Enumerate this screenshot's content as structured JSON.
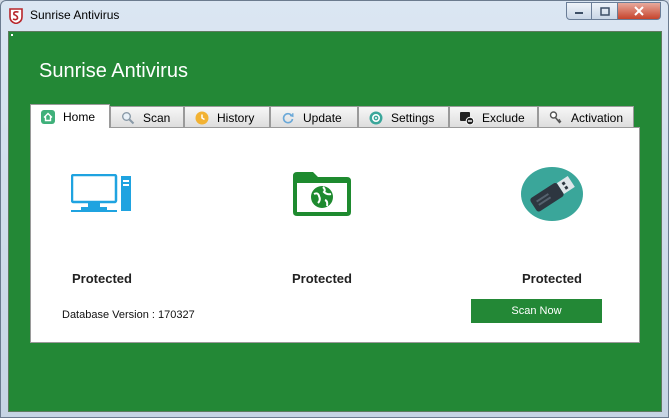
{
  "window": {
    "title": "Sunrise Antivirus"
  },
  "app": {
    "heading": "Sunrise Antivirus"
  },
  "tabs": [
    {
      "label": "Home",
      "icon": "home-icon"
    },
    {
      "label": "Scan",
      "icon": "magnifier-icon"
    },
    {
      "label": "History",
      "icon": "history-icon"
    },
    {
      "label": "Update",
      "icon": "refresh-icon"
    },
    {
      "label": "Settings",
      "icon": "gear-icon"
    },
    {
      "label": "Exclude",
      "icon": "exclude-icon"
    },
    {
      "label": "Activation",
      "icon": "key-icon"
    }
  ],
  "home": {
    "status_items": [
      {
        "icon": "computer-icon",
        "label": "Protected"
      },
      {
        "icon": "folder-globe-icon",
        "label": "Protected"
      },
      {
        "icon": "usb-drive-icon",
        "label": "Protected"
      }
    ],
    "database_version": "Database Version : 170327",
    "scan_button": "Scan Now"
  },
  "colors": {
    "brand_green": "#238836",
    "icon_blue": "#1fa3e0",
    "icon_teal": "#3aa69a"
  }
}
